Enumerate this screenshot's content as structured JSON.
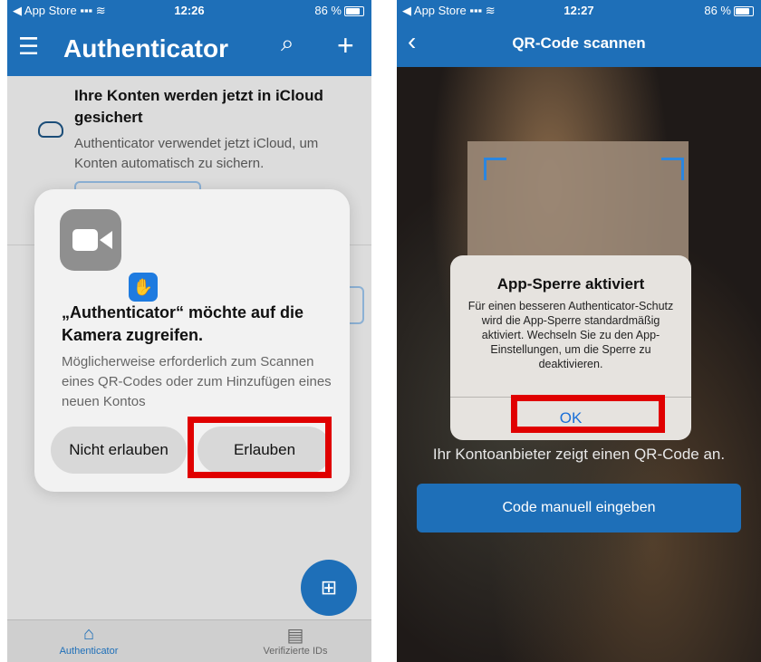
{
  "left": {
    "status": {
      "carrier": "◀ App Store",
      "signal": "▪▪▪",
      "wifi": "≋",
      "time": "12:26",
      "battery": "86 %"
    },
    "header": {
      "title": "Authenticator",
      "menu_icon": "☰",
      "search_icon": "⌕",
      "add_icon": "+"
    },
    "banner": {
      "title": "Ihre Konten werden jetzt in iCloud gesichert",
      "text": "Authenticator verwendet jetzt iCloud, um Konten automatisch zu sichern."
    },
    "dialog": {
      "title": "„Authenticator“ möchte auf die Kamera zugreifen.",
      "text": "Möglicherweise erforderlich zum Scannen eines QR-Codes oder zum Hinzufügen eines neuen Kontos",
      "deny_label": "Nicht erlauben",
      "allow_label": "Erlauben",
      "badge_icon": "✋"
    },
    "fab_icon": "⊞",
    "tabs": [
      {
        "label": "Authenticator",
        "icon": "⌂"
      },
      {
        "label": "Verifizierte IDs",
        "icon": "▤"
      }
    ]
  },
  "right": {
    "status": {
      "carrier": "◀ App Store",
      "signal": "▪▪▪",
      "wifi": "≋",
      "time": "12:27",
      "battery": "86 %"
    },
    "header": {
      "title": "QR-Code scannen",
      "back_icon": "‹"
    },
    "alert": {
      "title": "App-Sperre aktiviert",
      "text": "Für einen besseren Authenticator-Schutz wird die App-Sperre standardmäßig aktiviert. Wechseln Sie zu den App-Einstellungen, um die Sperre zu deaktivieren.",
      "ok_label": "OK"
    },
    "hint": "Ihr Kontoanbieter zeigt einen QR-Code an.",
    "manual_label": "Code manuell eingeben"
  },
  "colors": {
    "brand": "#1e6fb8",
    "highlight": "#e00000",
    "ios_link": "#1a6fd8"
  }
}
